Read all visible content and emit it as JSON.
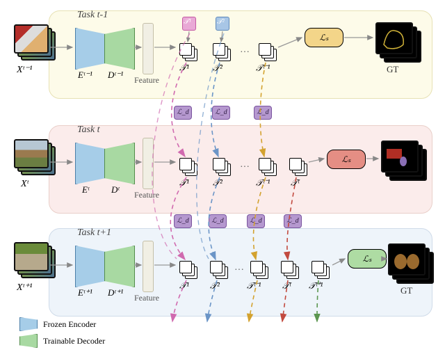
{
  "domain": "Diagram (deep-learning continual segmentation architecture figure)",
  "rows": [
    {
      "task_label": "Task t-1",
      "input_symbol": "Xᵗ⁻¹",
      "encoder_label": "Eᵗ⁻¹",
      "decoder_label": "Dᵗ⁻¹",
      "feature_label": "Feature",
      "top_tokens": [
        "𝒯¹",
        "𝒯²"
      ],
      "token_groups": [
        "𝒯¹",
        "𝒯²",
        "𝒯ᵗ⁻¹"
      ],
      "loss_s_color": "yellow",
      "gt_label": "GT"
    },
    {
      "task_label": "Task t",
      "input_symbol": "Xᵗ",
      "encoder_label": "Eᵗ",
      "decoder_label": "Dᵗ",
      "feature_label": "Feature",
      "token_groups": [
        "𝒯¹",
        "𝒯²",
        "𝒯ᵗ⁻¹",
        "𝒯ᵗ"
      ],
      "loss_s_color": "red"
    },
    {
      "task_label": "Task t+1",
      "input_symbol": "Xᵗ⁺¹",
      "encoder_label": "Eᵗ⁺¹",
      "decoder_label": "Dᵗ⁺¹",
      "feature_label": "Feature",
      "token_groups": [
        "𝒯¹",
        "𝒯²",
        "𝒯ᵗ⁻¹",
        "𝒯ᵗ",
        "𝒯ᵗ⁺¹"
      ],
      "loss_s_color": "green",
      "gt_label": "GT"
    }
  ],
  "loss_seg": "ℒₛ",
  "loss_distill": "ℒ_d",
  "legend": {
    "frozen": "Frozen Encoder",
    "trainable": "Trainable Decoder"
  },
  "chart_data": {
    "type": "diagram",
    "nodes": [
      "Input images X^{t-1}",
      "Frozen Encoder E^{t-1}",
      "Trainable Decoder D^{t-1}",
      "Feature (t-1)",
      "Task tokens T^1..T^{t-1} (row t-1)",
      "Segmentation loss L_s (yellow)",
      "Ground Truth GT (t-1)",
      "Input images X^{t}",
      "Frozen Encoder E^{t}",
      "Trainable Decoder D^{t}",
      "Feature (t)",
      "Task tokens T^1..T^{t} (row t)",
      "Segmentation loss L_s (red)",
      "Ground Truth GT (t)",
      "Input images X^{t+1}",
      "Frozen Encoder E^{t+1}",
      "Trainable Decoder D^{t+1}",
      "Feature (t+1)",
      "Task tokens T^1..T^{t+1} (row t+1)",
      "Segmentation loss L_s (green)",
      "Ground Truth GT (t+1)"
    ],
    "edges": [
      "X → E → D → Feature → token groups → L_s → GT  (within each task row)",
      "Distillation L_d arrows: each token group T^k at task row r is distilled to the same T^k at row r+1 (dashed, colored per token)"
    ],
    "colors": {
      "T^1": "pink",
      "T^2": "lightblue",
      "T^{t-1}": "yellow",
      "T^{t}": "red",
      "T^{t+1}": "green",
      "L_d": "purple"
    }
  }
}
